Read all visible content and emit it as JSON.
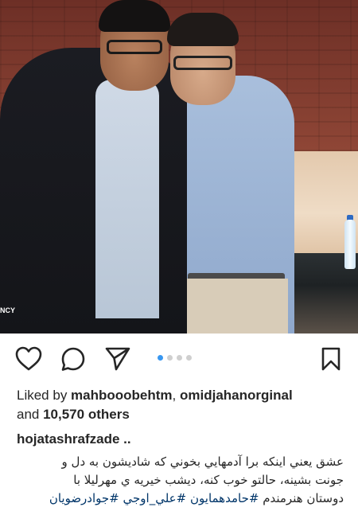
{
  "post": {
    "photo": {
      "edge_text": "NCY"
    },
    "carousel": {
      "count": 4,
      "active_index": 0
    },
    "likes": {
      "prefix": "Liked by ",
      "user1": "mahbooobehtm",
      "separator": ", ",
      "user2": "omidjahanorginal",
      "and": "and ",
      "count": "10,570 others"
    },
    "caption": {
      "username": "hojatashrafzade",
      "ellipsis": " ..",
      "line1": "عشق يعني اينكه برا آدمهايي بخوني كه شاديشون به دل و",
      "line2": "جونت بشينه، حالتو خوب كنه، ديشب خيريه ي مهرليلا با",
      "line3_text": "دوستان هنرمندم ",
      "hashtag1": "#حامدهمايون",
      "hashtag2": "#علي_اوجي",
      "hashtag3": "#جوادرضويان"
    },
    "icons": {
      "like": "heart-icon",
      "comment": "comment-icon",
      "share": "send-icon",
      "save": "bookmark-icon"
    },
    "colors": {
      "text": "#262626",
      "carousel_active": "#3897f0",
      "carousel_inactive": "#cfcfcf",
      "hashtag": "#003569"
    }
  }
}
